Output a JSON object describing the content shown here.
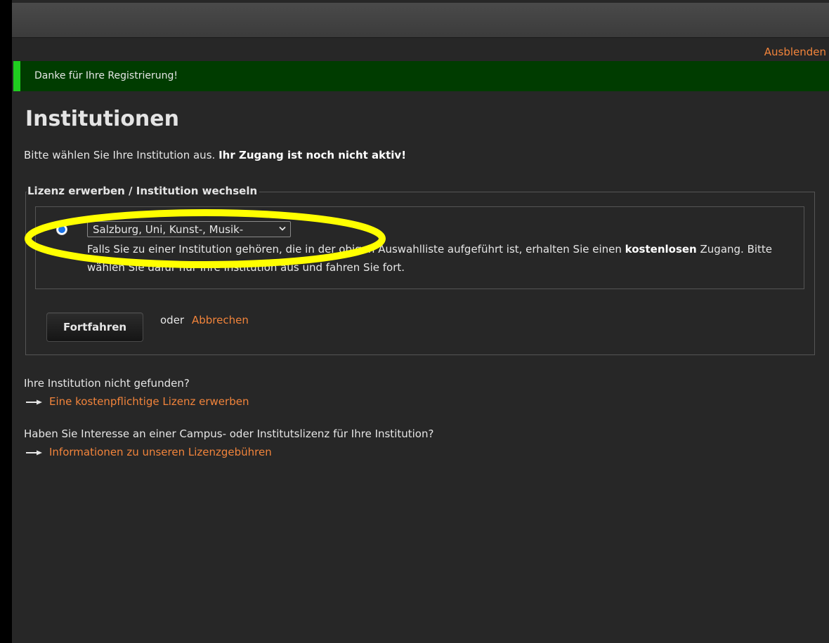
{
  "notification": {
    "hide_label": "Ausblenden",
    "message": "Danke für Ihre Registrierung!"
  },
  "page": {
    "title": "Institutionen",
    "intro": "Bitte wählen Sie Ihre Institution aus.",
    "intro_warning": "Ihr Zugang ist noch nicht aktiv!"
  },
  "license_form": {
    "legend": "Lizenz erwerben / Institution wechseln",
    "institution_select": {
      "selected": "Salzburg, Uni, Kunst-, Musik-"
    },
    "option_text_before": "Falls Sie zu einer Institution gehören, die in der obigen Auswahlliste aufgeführt ist, erhalten Sie einen",
    "option_text_bold": "kostenlosen",
    "option_text_after": "Zugang. Bitte wählen Sie dafür nur Ihre Institution aus und fahren Sie fort.",
    "continue_label": "Fortfahren",
    "or_label": "oder",
    "cancel_label": "Abbrechen"
  },
  "help": {
    "not_found_question": "Ihre Institution nicht gefunden?",
    "paid_license_link": "Eine kostenpflichtige Lizenz erwerben",
    "campus_question": "Haben Sie Interesse an einer Campus- oder Institutslizenz für Ihre Institution?",
    "fees_link": "Informationen zu unseren Lizenzgebühren"
  },
  "colors": {
    "background": "#272727",
    "accent_link": "#f2843b",
    "notice_background": "#003c00",
    "notice_stripe": "#1fce1f",
    "highlight_ellipse": "#ffff00"
  },
  "icons": {
    "select_chevron": "chevron-down-icon",
    "link_arrow": "arrow-right-icon"
  }
}
